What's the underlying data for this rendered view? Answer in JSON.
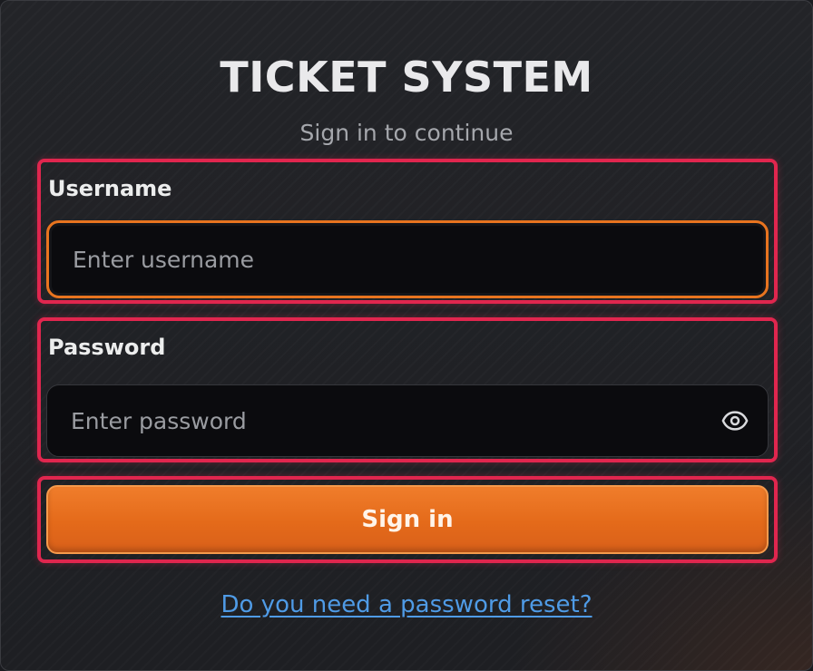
{
  "header": {
    "title": "TICKET SYSTEM",
    "subtitle": "Sign in to continue"
  },
  "form": {
    "username": {
      "label": "Username",
      "value": "",
      "placeholder": "Enter username"
    },
    "password": {
      "label": "Password",
      "value": "",
      "placeholder": "Enter password",
      "toggle_icon": "eye-icon"
    },
    "submit_label": "Sign in",
    "reset_link_label": "Do you need a password reset?"
  },
  "colors": {
    "accent": "#e8741f",
    "highlight": "#e0264e",
    "link": "#4f9be6"
  }
}
